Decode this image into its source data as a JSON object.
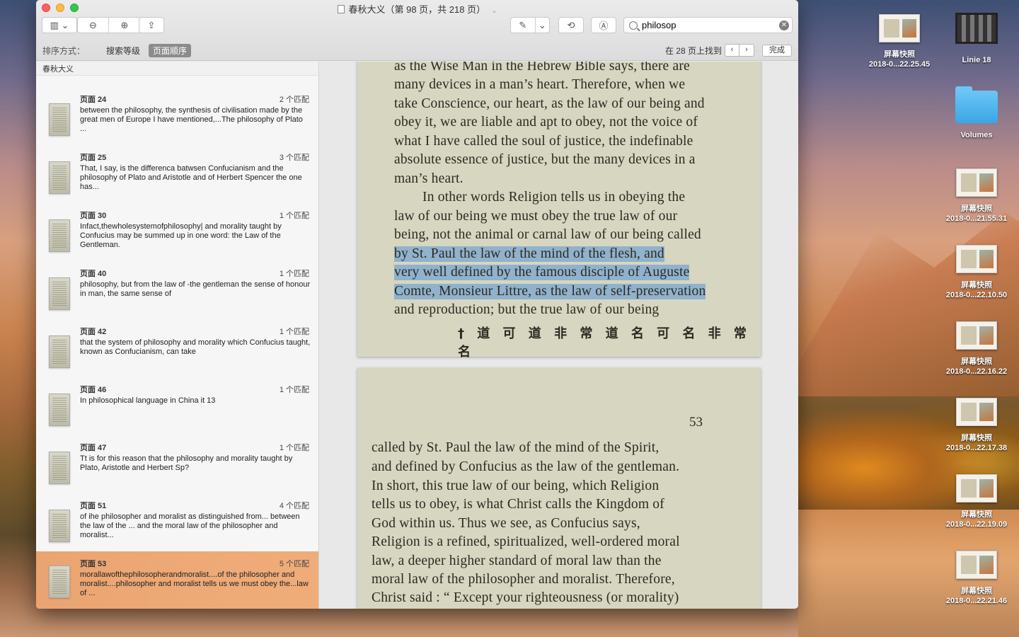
{
  "window": {
    "title": "春秋大义（第 98 页，共 218 页）"
  },
  "toolbar": {
    "search_value": "philosop"
  },
  "sortbar": {
    "label": "排序方式：",
    "options": [
      "搜索等级",
      "页面顺序"
    ],
    "found_text": "在 28 页上找到",
    "done_label": "完成"
  },
  "sidebar": {
    "header": "春秋大义",
    "results": [
      {
        "page": "页面 24",
        "count": "2 个匹配",
        "snippet": "between the philosophy, the synthesis of civilisation made by the great men of Europe I have mentioned,...The philosophy of Plato ..."
      },
      {
        "page": "页面 25",
        "count": "3 个匹配",
        "snippet": "That, I say, is the differenca batwsen Confucianism and the philosophy of Plato and Aristotle and of Herbert Spencer the one has..."
      },
      {
        "page": "页面 30",
        "count": "1 个匹配",
        "snippet": "Infact,thewholesystemofphilosophy| and morality taught by Confucius may be summed up in one word: the Law of the Gentleman."
      },
      {
        "page": "页面 40",
        "count": "1 个匹配",
        "snippet": "philosophy, but from the law of -the gentleman the sense of honour in man, the same sense of"
      },
      {
        "page": "页面 42",
        "count": "1 个匹配",
        "snippet": "that the system of philosophy and morality which Confucius taught, known as Confucianism, can take"
      },
      {
        "page": "页面 46",
        "count": "1 个匹配",
        "snippet": "In philosophical language in China it 13"
      },
      {
        "page": "页面 47",
        "count": "1 个匹配",
        "snippet": "Tt is for this reason that the philosophy and morality taught by Plato, Aristotle and Herbert Sp?"
      },
      {
        "page": "页面 51",
        "count": "4 个匹配",
        "snippet": "of ihe philosopher and moralist as distinguished from... between the law of the ... and the moral law of the philosopher and moralist..."
      },
      {
        "page": "页面 53",
        "count": "5 个匹配",
        "snippet": "morallawofthephilosopherandmoralist....of the philosopher and moralist....philosopher and moralist tells us we must obey the...law of ..."
      }
    ]
  },
  "document": {
    "page1_lines": [
      "as the Wise Man in the Hebrew Bible says, there are",
      "many devices in a man’s heart. Therefore, when we",
      "take Conscience, our heart, as the law of our being and",
      "obey it, we are liable and apt to obey, not the voice of",
      "what I have called the soul of justice, the indefinable",
      "absolute essence of justice, but the many devices in a",
      "man’s heart.",
      "In other words Religion tells us in obeying the",
      "law of our being we must obey the true law of our",
      "being, not the animal or carnal law of our being called",
      "by St. Paul the law of the mind of the flesh, and",
      "very well defined by the famous disciple of Auguste",
      "Comte, Monsieur Littre, as the law of self-preservation",
      "and reproduction; but the true law of our being"
    ],
    "page1_footnote": "† 道 可 道 非 常 道 名 可 名 非 常 名",
    "page2_number": "53",
    "page2_lines": [
      "called by St. Paul the law of the mind of the Spirit,",
      "and defined by Confucius as the law of the gentleman.",
      "In short, this true law of our being, which Religion",
      "tells us to obey, is what Christ calls the Kingdom of",
      "God within us. Thus we see, as Confucius says,",
      "Religion is a refined, spiritualized, well-ordered moral",
      "law, a deeper higher standard of moral law than the",
      "moral law of the philosopher and moralist. Therefore,",
      "Christ said : “ Except your righteousness (or morality)"
    ]
  },
  "desktop": {
    "icons": [
      {
        "label": "屏幕快照\n2018-0...22.25.45"
      },
      {
        "label": "Linie 18"
      },
      {
        "label": "Volumes"
      },
      {
        "label": "屏幕快照\n2018-0...21.55.31"
      },
      {
        "label": "屏幕快照\n2018-0...22.10.50"
      },
      {
        "label": "屏幕快照\n2018-0...22.16.22"
      },
      {
        "label": "屏幕快照\n2018-0...22.17.38"
      },
      {
        "label": "屏幕快照\n2018-0...22.19.09"
      },
      {
        "label": "屏幕快照\n2018-0...22.21.46"
      }
    ]
  }
}
